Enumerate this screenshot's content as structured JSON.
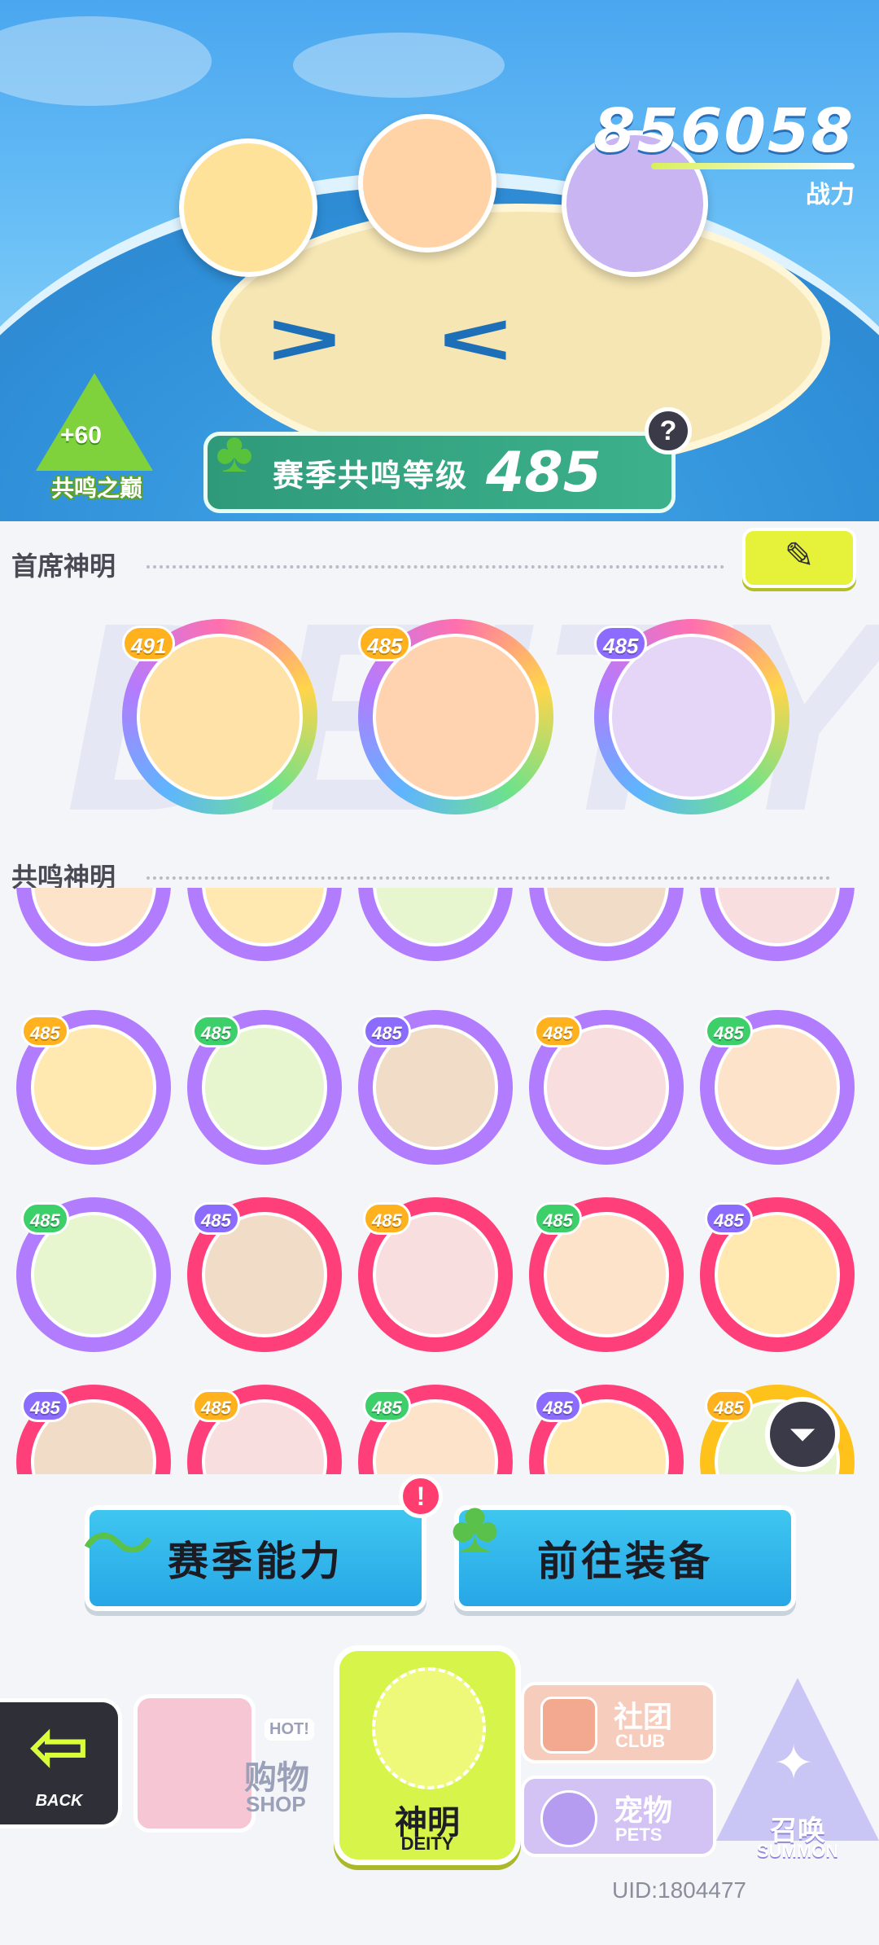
{
  "header": {
    "combat_power": "856058",
    "combat_power_label": "战力",
    "peak_badge": {
      "bonus": "+60",
      "label": "共鸣之巅"
    },
    "season_resonance": {
      "label": "赛季共鸣等级",
      "level": "485"
    },
    "help_icon": "?"
  },
  "sections": {
    "lead_title": "首席神明",
    "resonance_title": "共鸣神明",
    "watermark": "DEITY"
  },
  "lead_deities": [
    {
      "level": "491",
      "face": "#ffe2a8"
    },
    {
      "level": "485",
      "face": "#ffd2b0"
    },
    {
      "level": "485",
      "face": "#e5d6f7"
    }
  ],
  "grid": {
    "rows": [
      [
        {
          "level": "",
          "color": "#b27cff"
        },
        {
          "level": "",
          "color": "#b27cff"
        },
        {
          "level": "",
          "color": "#b27cff"
        },
        {
          "level": "",
          "color": "#b27cff"
        },
        {
          "level": "",
          "color": "#b27cff"
        }
      ],
      [
        {
          "level": "485",
          "color": "#b27cff"
        },
        {
          "level": "485",
          "color": "#b27cff"
        },
        {
          "level": "485",
          "color": "#b27cff"
        },
        {
          "level": "485",
          "color": "#b27cff"
        },
        {
          "level": "485",
          "color": "#b27cff"
        }
      ],
      [
        {
          "level": "485",
          "color": "#b27cff"
        },
        {
          "level": "485",
          "color": "#ff3f7a"
        },
        {
          "level": "485",
          "color": "#ff3f7a"
        },
        {
          "level": "485",
          "color": "#ff3f7a"
        },
        {
          "level": "485",
          "color": "#ff3f7a"
        }
      ],
      [
        {
          "level": "485",
          "color": "#ff3f7a"
        },
        {
          "level": "485",
          "color": "#ff3f7a"
        },
        {
          "level": "485",
          "color": "#ff3f7a"
        },
        {
          "level": "485",
          "color": "#ff3f7a"
        },
        {
          "level": "485",
          "color": "#ffc21a"
        }
      ]
    ]
  },
  "actions": {
    "season_ability": "赛季能力",
    "go_equipment": "前往装备",
    "alert": "!"
  },
  "nav": {
    "back": "BACK",
    "shop_cn": "购物",
    "shop_en": "SHOP",
    "shop_hot": "HOT!",
    "deity_cn": "神明",
    "deity_en": "DEITY",
    "club_cn": "社团",
    "club_en": "CLUB",
    "pets_cn": "宠物",
    "pets_en": "PETS",
    "summon_cn": "召唤",
    "summon_en": "SUMMON"
  },
  "uid": "UID:1804477",
  "colors": {
    "level_badge": "#ffb21e",
    "level_badge_alt": "#8c6cff",
    "level_badge_green": "#3ccf6a"
  }
}
